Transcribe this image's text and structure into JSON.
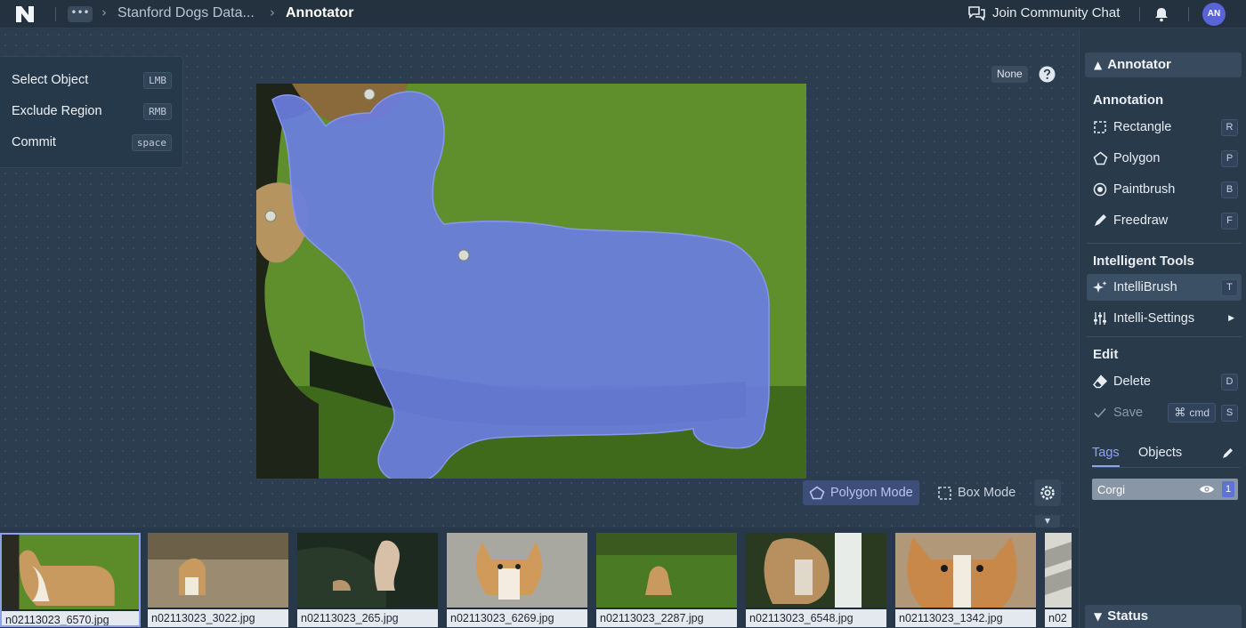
{
  "topbar": {
    "breadcrumb_more": "•••",
    "dataset": "Stanford Dogs Data...",
    "current_page": "Annotator",
    "community_label": "Join Community Chat",
    "avatar_initials": "AN"
  },
  "hotkeys": [
    {
      "label": "Select Object",
      "key": "LMB"
    },
    {
      "label": "Exclude Region",
      "key": "RMB"
    },
    {
      "label": "Commit",
      "key": "space"
    }
  ],
  "canvas": {
    "class_badge": "None"
  },
  "modes": {
    "polygon": "Polygon Mode",
    "box": "Box Mode"
  },
  "sidebar": {
    "header": "Annotator",
    "annotation_title": "Annotation",
    "annotation_items": [
      {
        "label": "Rectangle",
        "key": "R",
        "icon": "rectangle-icon"
      },
      {
        "label": "Polygon",
        "key": "P",
        "icon": "polygon-icon"
      },
      {
        "label": "Paintbrush",
        "key": "B",
        "icon": "paintbrush-icon"
      },
      {
        "label": "Freedraw",
        "key": "F",
        "icon": "pencil-icon"
      }
    ],
    "intelligent_title": "Intelligent Tools",
    "intelligent_items": [
      {
        "label": "IntelliBrush",
        "key": "T",
        "icon": "sparkle-icon",
        "active": true
      },
      {
        "label": "Intelli-Settings",
        "icon": "sliders-icon"
      }
    ],
    "edit_title": "Edit",
    "edit_items": [
      {
        "label": "Delete",
        "key": "D",
        "icon": "eraser-icon"
      },
      {
        "label": "Save",
        "modifier": "cmd",
        "key": "S",
        "icon": "check-icon",
        "disabled": true
      }
    ],
    "tabs": [
      "Tags",
      "Objects"
    ],
    "active_tab": "Tags",
    "tags": [
      {
        "name": "Corgi",
        "count": "1"
      }
    ],
    "status_header": "Status"
  },
  "filmstrip": [
    {
      "filename": "n02113023_6570.jpg",
      "selected": true
    },
    {
      "filename": "n02113023_3022.jpg"
    },
    {
      "filename": "n02113023_265.jpg"
    },
    {
      "filename": "n02113023_6269.jpg"
    },
    {
      "filename": "n02113023_2287.jpg"
    },
    {
      "filename": "n02113023_6548.jpg"
    },
    {
      "filename": "n02113023_1342.jpg"
    },
    {
      "filename": "n02"
    }
  ],
  "colors": {
    "accent": "#8fa4f0",
    "mask_fill": "#6a7ee0",
    "grass": "#5a8a2a",
    "background": "#2a3a4c"
  }
}
